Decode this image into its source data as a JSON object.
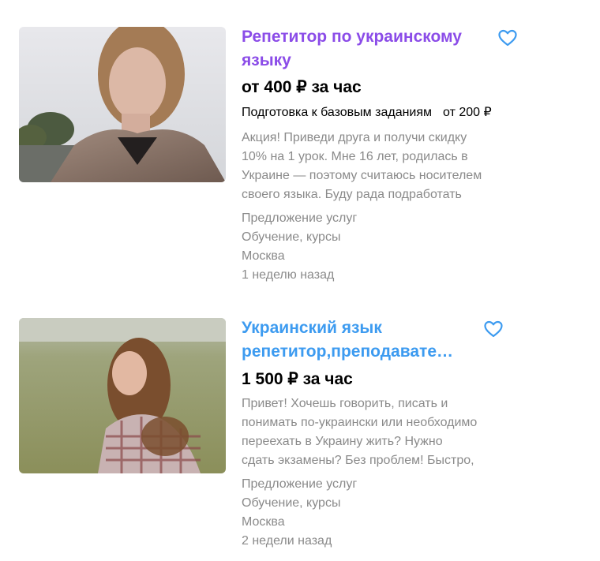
{
  "colors": {
    "title_visited": "#8b4ce8",
    "title_link": "#3d9bf0",
    "heart": "#3d9bf0",
    "muted_text": "#8a8a8a"
  },
  "listings": [
    {
      "title_lines": [
        "Репетитор по украинскому",
        "языку"
      ],
      "price": "от 400 ₽ за час",
      "subprice_label": "Подготовка к базовым заданиям",
      "subprice_amount": "от 200 ₽",
      "description_lines": [
        "Акция! Приведи друга и получи скидку",
        "10% на 1 урок. Мне 16 лет, родилась в",
        "Украине — поэтому считаюсь носителем",
        "своего языка. Буду рада подработать"
      ],
      "type": "Предложение услуг",
      "category": "Обучение, курсы",
      "city": "Москва",
      "date": "1 неделю назад",
      "favorite_icon": "heart-outline-icon"
    },
    {
      "title_lines": [
        "Украинский язык",
        "репетитор,преподавате…"
      ],
      "price": "1 500 ₽ за час",
      "description_lines": [
        "Привет! Хочешь говорить, писать и",
        "понимать по-украински или необходимо",
        "переехать в Украину жить? Нужно",
        "сдать экзамены? Без проблем! Быстро,"
      ],
      "type": "Предложение услуг",
      "category": "Обучение, курсы",
      "city": "Москва",
      "date": "2 недели назад",
      "favorite_icon": "heart-outline-icon"
    }
  ]
}
